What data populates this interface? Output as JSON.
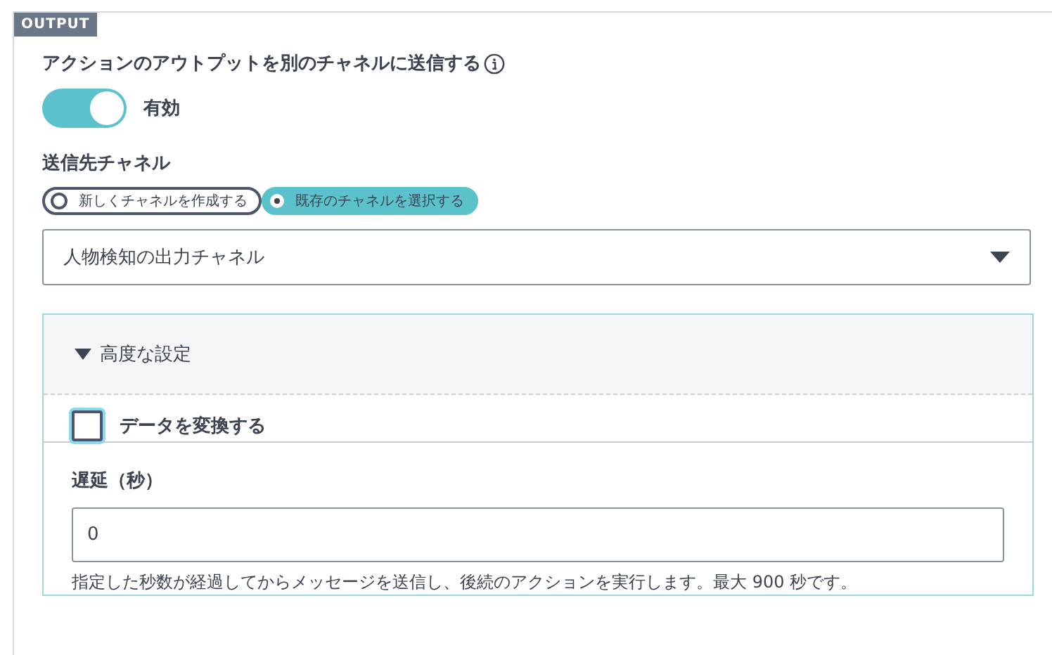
{
  "section_tag": "OUTPUT",
  "send_output": {
    "label": "アクションのアウトプットを別のチャネルに送信する",
    "on": true,
    "state_label": "有効"
  },
  "destination": {
    "label": "送信先チャネル",
    "options": [
      {
        "label": "新しくチャネルを作成する",
        "selected": false
      },
      {
        "label": "既存のチャネルを選択する",
        "selected": true
      }
    ],
    "channel": "人物検知の出力チャネル"
  },
  "advanced": {
    "title": "高度な設定",
    "expanded": true,
    "transform": {
      "label": "データを変換する",
      "checked": false
    },
    "delay": {
      "label": "遅延（秒）",
      "value": "0",
      "hint": "指定した秒数が経過してからメッセージを送信し、後続のアクションを実行します。最大 900 秒です。"
    }
  }
}
